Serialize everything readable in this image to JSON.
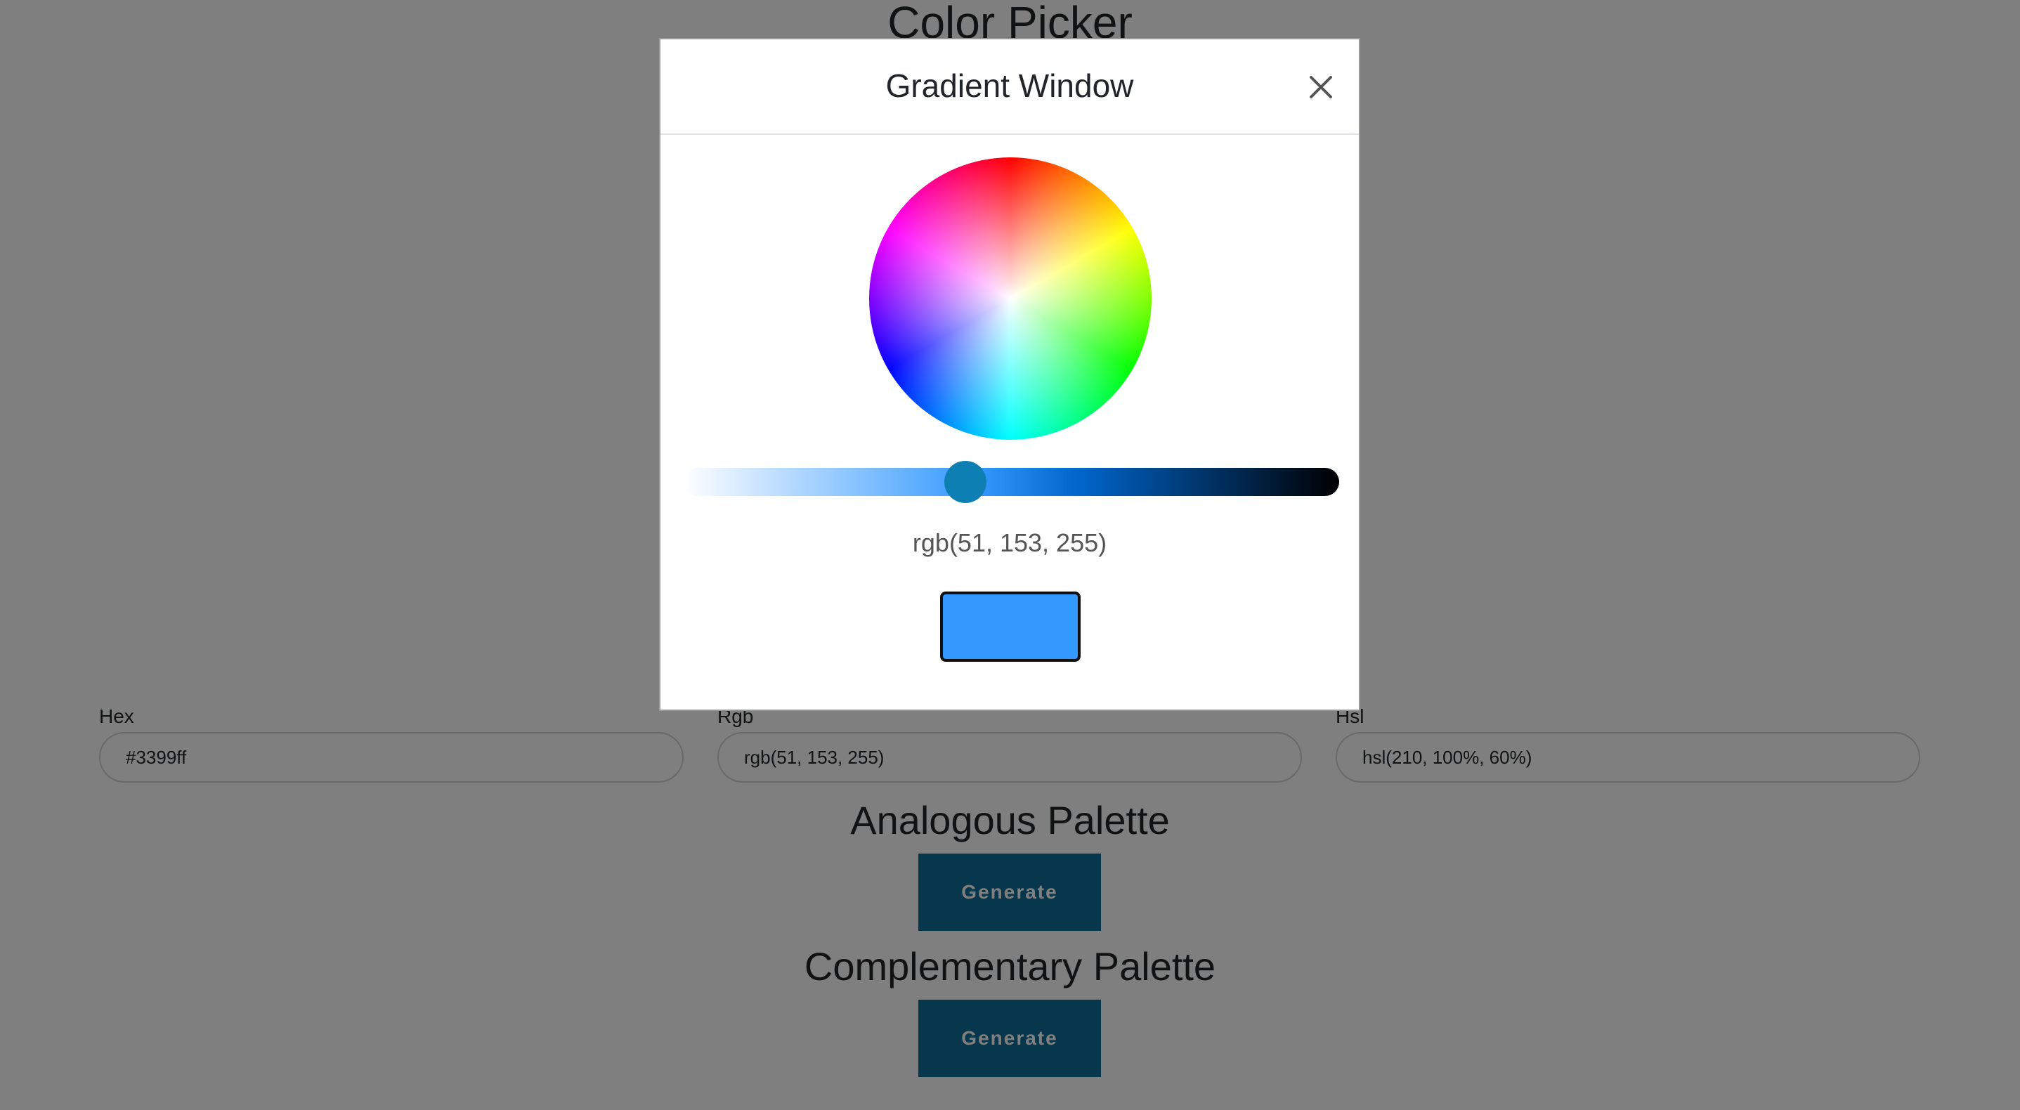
{
  "page": {
    "title": "Color Picker"
  },
  "fields": {
    "hex": {
      "label": "Hex",
      "value": "#3399ff"
    },
    "rgb": {
      "label": "Rgb",
      "value": "rgb(51, 153, 255)"
    },
    "hsl": {
      "label": "Hsl",
      "value": "hsl(210, 100%, 60%)"
    }
  },
  "analogous": {
    "title": "Analogous Palette",
    "button_label": "Generate"
  },
  "complementary": {
    "title": "Complementary Palette",
    "button_label": "Generate"
  },
  "modal": {
    "title": "Gradient Window",
    "close_icon": "close-icon",
    "color_text": "rgb(51, 153, 255)",
    "selected_color": "#3399ff",
    "shade_level": 0.43
  },
  "colors": {
    "accent": "#0d6e9a",
    "thumb": "#0d7fb3",
    "swatch": "#3399ff"
  }
}
